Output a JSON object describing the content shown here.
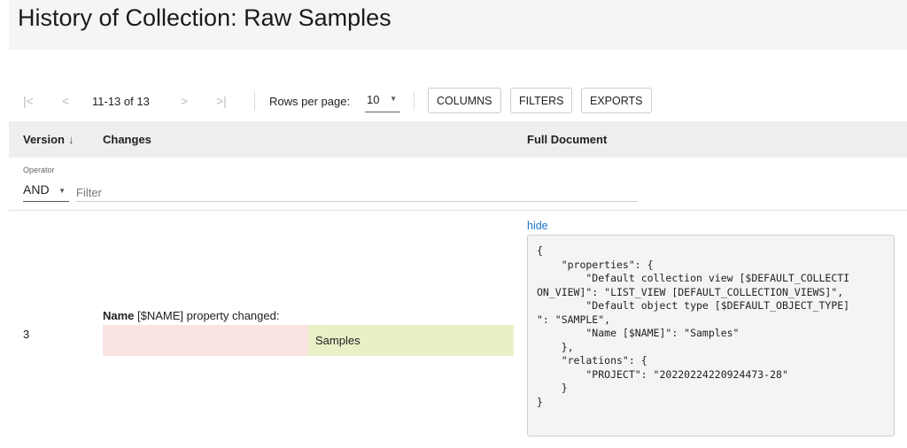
{
  "page": {
    "title": "History of Collection: Raw Samples"
  },
  "toolbar": {
    "first_icon": "first-page-icon",
    "prev_icon": "prev-page-icon",
    "next_icon": "next-page-icon",
    "last_icon": "last-page-icon",
    "range": "11-13 of 13",
    "rows_per_page_label": "Rows per page:",
    "rows_per_page_value": "10",
    "columns_label": "COLUMNS",
    "filters_label": "FILTERS",
    "exports_label": "EXPORTS"
  },
  "table": {
    "headers": {
      "version": "Version",
      "changes": "Changes",
      "full_document": "Full Document"
    },
    "sort_icon": "arrow-down-icon",
    "filter": {
      "operator_label": "Operator",
      "operator_value": "AND",
      "placeholder": "Filter"
    },
    "rows": [
      {
        "version": "3",
        "change_property": "Name",
        "change_text": " [$NAME] property changed:",
        "old_value": "",
        "new_value": "Samples",
        "hide_label": "hide",
        "document": "{\n    \"properties\": {\n        \"Default collection view [$DEFAULT_COLLECTI\nON_VIEW]\": \"LIST_VIEW [DEFAULT_COLLECTION_VIEWS]\",\n        \"Default object type [$DEFAULT_OBJECT_TYPE]\n\": \"SAMPLE\",\n        \"Name [$NAME]\": \"Samples\"\n    },\n    \"relations\": {\n        \"PROJECT\": \"20220224220924473-28\"\n    }\n}"
      }
    ]
  },
  "colors": {
    "link": "#1976d2",
    "diff_removed": "#fbe3e3",
    "diff_added": "#e9f0c6",
    "header_bg": "#eeeeee"
  }
}
